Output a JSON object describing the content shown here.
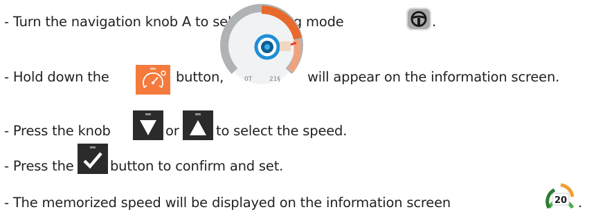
{
  "instructions": [
    {
      "bullet": "-",
      "text": "Turn the navigation knob A to select driving mode",
      "suffix": ".",
      "icon": "steering-wheel-icon"
    },
    {
      "bullet": "-",
      "text_before": "Hold down the",
      "icon_button": "speedometer-button-icon",
      "text_middle": "button,",
      "icon_display": "speed-gauge-display-icon",
      "gauge_label_left": "0T",
      "gauge_label_right": "21§",
      "text_after": "will appear on the information screen."
    },
    {
      "bullet": "-",
      "text_before": "Press the knob",
      "icon_down": "arrow-down-button-icon",
      "text_middle": "or",
      "icon_up": "arrow-up-button-icon",
      "text_after": "to select the speed."
    },
    {
      "bullet": "-",
      "text_before": "Press the",
      "icon_confirm": "checkmark-button-icon",
      "text_after": "button to confirm and set."
    },
    {
      "bullet": "-",
      "text": "The memorized speed will be displayed on the information screen",
      "icon_memory": "memorized-speed-gauge-icon",
      "memory_value": "20",
      "suffix": "."
    }
  ],
  "colors": {
    "text": "#231f20",
    "orange_button": "#f47b3d",
    "dark_button": "#2b2b2b",
    "gauge_blue": "#1e8fd6"
  }
}
